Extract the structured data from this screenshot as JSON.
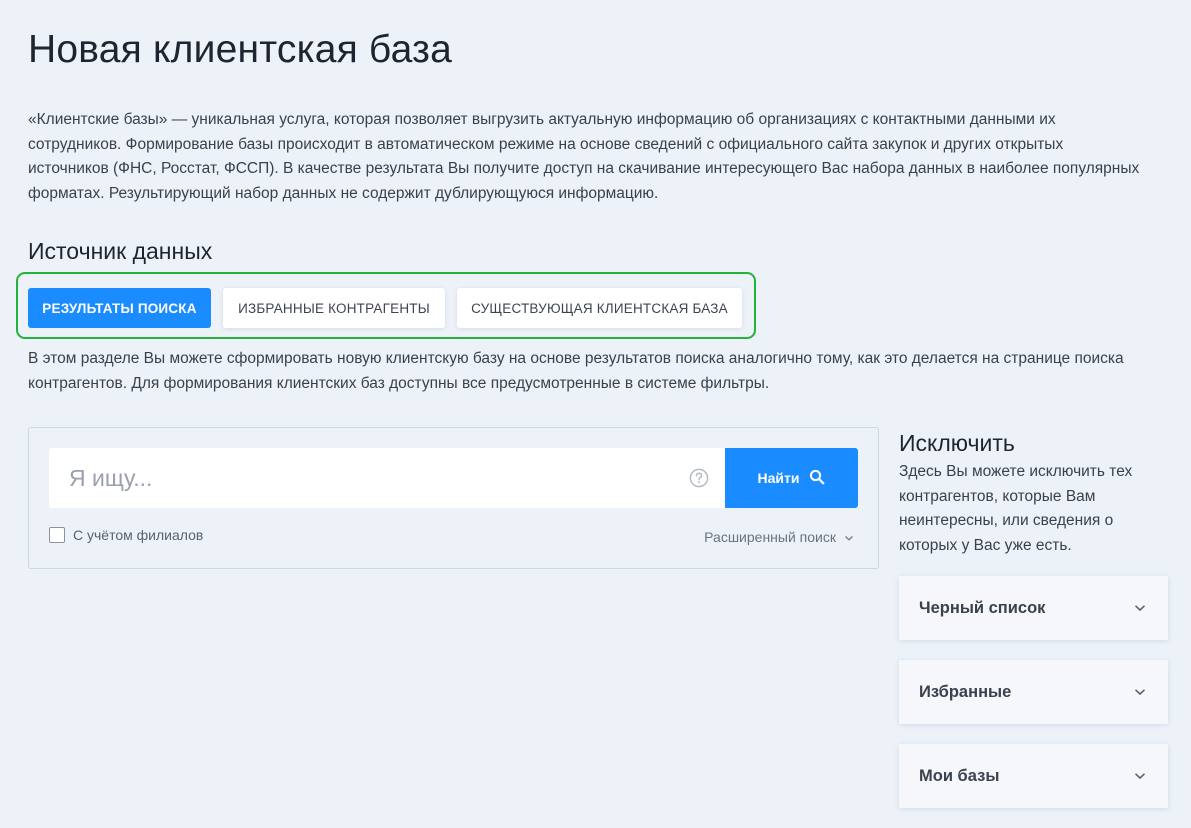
{
  "page": {
    "title": "Новая клиентская база",
    "intro": "«Клиентские базы» — уникальная услуга, которая позволяет выгрузить актуальную информацию об организациях с контактными данными их сотрудников. Формирование базы происходит в автоматическом режиме на основе сведений с официального сайта закупок и других открытых источников (ФНС, Росстат, ФССП). В качестве результата Вы получите доступ на скачивание интересующего Вас набора данных в наиболее популярных форматах. Результирующий набор данных не содержит дублирующуюся информацию."
  },
  "source": {
    "title": "Источник данных",
    "tabs": [
      {
        "label": "Результаты поиска",
        "active": true
      },
      {
        "label": "Избранные контрагенты",
        "active": false
      },
      {
        "label": "Существующая клиентская база",
        "active": false
      }
    ],
    "description": "В этом разделе Вы можете сформировать новую клиентскую базу на основе результатов поиска аналогично тому, как это делается на странице поиска контрагентов. Для формирования клиентских баз доступны все предусмотренные в системе фильтры."
  },
  "search": {
    "placeholder": "Я ищу...",
    "value": "",
    "button_label": "Найти",
    "branches_label": "С учётом филиалов",
    "branches_checked": false,
    "advanced_label": "Расширенный поиск"
  },
  "exclude": {
    "title": "Исключить",
    "description": "Здесь Вы можете исключить тех контрагентов, которые Вам неинтересны, или сведения о которых у Вас уже есть.",
    "items": [
      {
        "label": "Черный список"
      },
      {
        "label": "Избранные"
      },
      {
        "label": "Мои базы"
      }
    ]
  },
  "colors": {
    "accent": "#1a8cff",
    "highlight_border": "#22b33a",
    "background": "#edf2f9"
  }
}
